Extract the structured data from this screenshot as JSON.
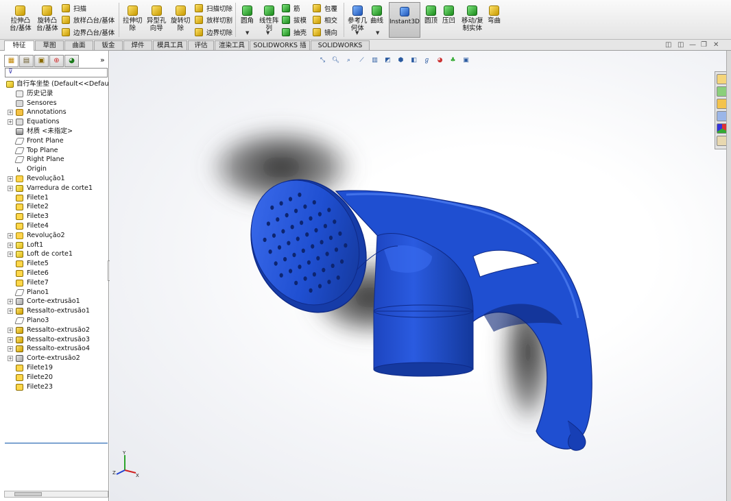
{
  "ribbon": {
    "features": [
      {
        "id": "extrude-boss",
        "label": "拉伸凸\n台/基体",
        "icon": "extrude-boss-icon"
      },
      {
        "id": "revolve-boss",
        "label": "旋转凸\n台/基体",
        "icon": "revolve-boss-icon"
      }
    ],
    "small_boss": [
      {
        "id": "sweep",
        "label": "扫描",
        "icon": "sweep-icon"
      },
      {
        "id": "loft",
        "label": "放样凸台/基体",
        "icon": "loft-icon"
      },
      {
        "id": "boundary",
        "label": "边界凸台/基体",
        "icon": "boundary-boss-icon"
      }
    ],
    "cuts": [
      {
        "id": "extrude-cut",
        "label": "拉伸切\n除",
        "icon": "extrude-cut-icon"
      },
      {
        "id": "hole-wizard",
        "label": "异型孔\n向导",
        "icon": "hole-wizard-icon"
      },
      {
        "id": "revolve-cut",
        "label": "旋转切\n除",
        "icon": "revolve-cut-icon"
      }
    ],
    "small_cut": [
      {
        "id": "sweep-cut",
        "label": "扫描切除",
        "icon": "sweep-cut-icon"
      },
      {
        "id": "loft-cut",
        "label": "放样切割",
        "icon": "loft-cut-icon"
      },
      {
        "id": "boundary-cut",
        "label": "边界切除",
        "icon": "boundary-cut-icon"
      }
    ],
    "fillet": {
      "label": "圆角",
      "icon": "fillet-icon"
    },
    "pattern": {
      "label": "线性阵\n列",
      "icon": "linear-pattern-icon"
    },
    "small_feat1": [
      {
        "id": "rib",
        "label": "筋",
        "icon": "rib-icon"
      },
      {
        "id": "draft",
        "label": "拔模",
        "icon": "draft-icon"
      },
      {
        "id": "shell",
        "label": "抽壳",
        "icon": "shell-icon"
      }
    ],
    "small_feat2": [
      {
        "id": "wrap",
        "label": "包覆",
        "icon": "wrap-icon"
      },
      {
        "id": "intersect",
        "label": "相交",
        "icon": "intersect-icon"
      },
      {
        "id": "mirror",
        "label": "镜向",
        "icon": "mirror-icon"
      }
    ],
    "ref_geom": {
      "label": "参考几\n何体",
      "icon": "reference-geometry-icon"
    },
    "curves": {
      "label": "曲线",
      "icon": "curves-icon"
    },
    "instant3d": {
      "label": "Instant3D",
      "icon": "instant3d-icon"
    },
    "dome": {
      "label": "圆顶",
      "icon": "dome-icon"
    },
    "indent": {
      "label": "压凹",
      "icon": "indent-icon"
    },
    "move_copy": {
      "label": "移动/复\n制实体",
      "icon": "move-copy-body-icon"
    },
    "flex": {
      "label": "弯曲",
      "icon": "flex-icon"
    }
  },
  "tabs": [
    {
      "label": "特征",
      "active": true
    },
    {
      "label": "草图"
    },
    {
      "label": "曲面"
    },
    {
      "label": "钣金"
    },
    {
      "label": "焊件"
    },
    {
      "label": "模具工具"
    },
    {
      "label": "评估"
    },
    {
      "label": "渲染工具"
    },
    {
      "label": "SOLIDWORKS 插件"
    },
    {
      "label": "SOLIDWORKS MBD"
    }
  ],
  "panel": {
    "tabs": [
      "feature-manager-icon",
      "property-manager-icon",
      "configuration-manager-icon",
      "dimxpert-icon",
      "display-manager-icon"
    ],
    "expand_chevron": "»",
    "filter_icon": "filter-icon"
  },
  "tree": {
    "root": "自行车坐垫  (Default<<Default",
    "items": [
      {
        "label": "历史记录",
        "icon": "history-icon",
        "type": "hist",
        "exp": false
      },
      {
        "label": "Sensores",
        "icon": "sensors-icon",
        "type": "sens",
        "exp": false
      },
      {
        "label": "Annotations",
        "icon": "annotations-icon",
        "type": "ann",
        "exp": true
      },
      {
        "label": "Equations",
        "icon": "equations-icon",
        "type": "eq",
        "exp": true
      },
      {
        "label": "材质 <未指定>",
        "icon": "material-icon",
        "type": "mat",
        "exp": false
      },
      {
        "label": "Front Plane",
        "icon": "plane-icon",
        "type": "plane",
        "exp": false
      },
      {
        "label": "Top Plane",
        "icon": "plane-icon",
        "type": "plane",
        "exp": false
      },
      {
        "label": "Right Plane",
        "icon": "plane-icon",
        "type": "plane",
        "exp": false
      },
      {
        "label": "Origin",
        "icon": "origin-icon",
        "type": "orig",
        "exp": false
      },
      {
        "label": "Revolução1",
        "icon": "revolve-feature-icon",
        "type": "rev",
        "exp": true
      },
      {
        "label": "Varredura de corte1",
        "icon": "sweep-cut-feature-icon",
        "type": "feat",
        "exp": true
      },
      {
        "label": "Filete1",
        "icon": "fillet-feature-icon",
        "type": "fil",
        "exp": false
      },
      {
        "label": "Filete2",
        "icon": "fillet-feature-icon",
        "type": "fil",
        "exp": false
      },
      {
        "label": "Filete3",
        "icon": "fillet-feature-icon",
        "type": "fil",
        "exp": false
      },
      {
        "label": "Filete4",
        "icon": "fillet-feature-icon",
        "type": "fil",
        "exp": false
      },
      {
        "label": "Revolução2",
        "icon": "revolve-feature-icon",
        "type": "rev",
        "exp": true
      },
      {
        "label": "Loft1",
        "icon": "loft-feature-icon",
        "type": "feat",
        "exp": true
      },
      {
        "label": "Loft de corte1",
        "icon": "loft-cut-feature-icon",
        "type": "feat",
        "exp": true
      },
      {
        "label": "Filete5",
        "icon": "fillet-feature-icon",
        "type": "fil",
        "exp": false
      },
      {
        "label": "Filete6",
        "icon": "fillet-feature-icon",
        "type": "fil",
        "exp": false
      },
      {
        "label": "Filete7",
        "icon": "fillet-feature-icon",
        "type": "fil",
        "exp": false
      },
      {
        "label": "Plano1",
        "icon": "plane-icon",
        "type": "plane",
        "exp": false
      },
      {
        "label": "Corte-extrusão1",
        "icon": "cut-extrude-feature-icon",
        "type": "cut",
        "exp": true
      },
      {
        "label": "Ressalto-extrusão1",
        "icon": "boss-extrude-feature-icon",
        "type": "rs",
        "exp": true
      },
      {
        "label": "Plano3",
        "icon": "plane-icon",
        "type": "plane",
        "exp": false
      },
      {
        "label": "Ressalto-extrusão2",
        "icon": "boss-extrude-feature-icon",
        "type": "rs",
        "exp": true
      },
      {
        "label": "Ressalto-extrusão3",
        "icon": "boss-extrude-feature-icon",
        "type": "rs",
        "exp": true
      },
      {
        "label": "Ressalto-extrusão4",
        "icon": "boss-extrude-feature-icon",
        "type": "rs",
        "exp": true
      },
      {
        "label": "Corte-extrusão2",
        "icon": "cut-extrude-feature-icon",
        "type": "cut",
        "exp": true
      },
      {
        "label": "Filete19",
        "icon": "fillet-feature-icon",
        "type": "fil",
        "exp": false
      },
      {
        "label": "Filete20",
        "icon": "fillet-feature-icon",
        "type": "fil",
        "exp": false
      },
      {
        "label": "Filete23",
        "icon": "fillet-feature-icon",
        "type": "fil",
        "exp": false
      }
    ]
  },
  "headsup": [
    "zoom-to-fit-icon",
    "zoom-to-area-icon",
    "previous-view-icon",
    "section-view-icon",
    "dynamic-annotation-icon",
    "view-orientation-icon",
    "display-style-icon",
    "hide-show-items-icon",
    "edit-appearance-icon",
    "apply-scene-icon",
    "view-settings-icon"
  ],
  "taskpane": [
    "solidworks-resources-icon",
    "design-library-icon",
    "file-explorer-icon",
    "view-palette-icon",
    "appearances-icon",
    "custom-properties-icon"
  ],
  "model": {
    "color": "#1f4fd1",
    "highlight": "#4f7ff0",
    "shade": "#102e8c"
  },
  "triad": {
    "x": "X",
    "y": "Y",
    "z": "Z"
  }
}
